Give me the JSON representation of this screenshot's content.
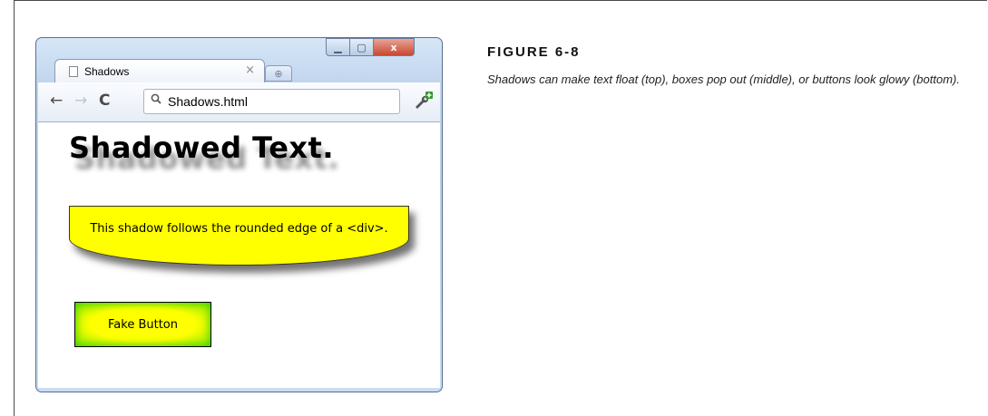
{
  "figure": {
    "label": "FIGURE 6-8",
    "caption": "Shadows can make text float (top), boxes pop out (middle), or buttons look glowy (bottom)."
  },
  "browser": {
    "tab_title": "Shadows",
    "tab_close": "×",
    "address": "Shadows.html",
    "close_glyph": "x"
  },
  "page": {
    "heading": "Shadowed Text.",
    "box_text": "This shadow follows the rounded edge of a <div>.",
    "button_label": "Fake Button"
  },
  "colors": {
    "box_fill": "#ffff00",
    "button_glow": "#86e800"
  }
}
